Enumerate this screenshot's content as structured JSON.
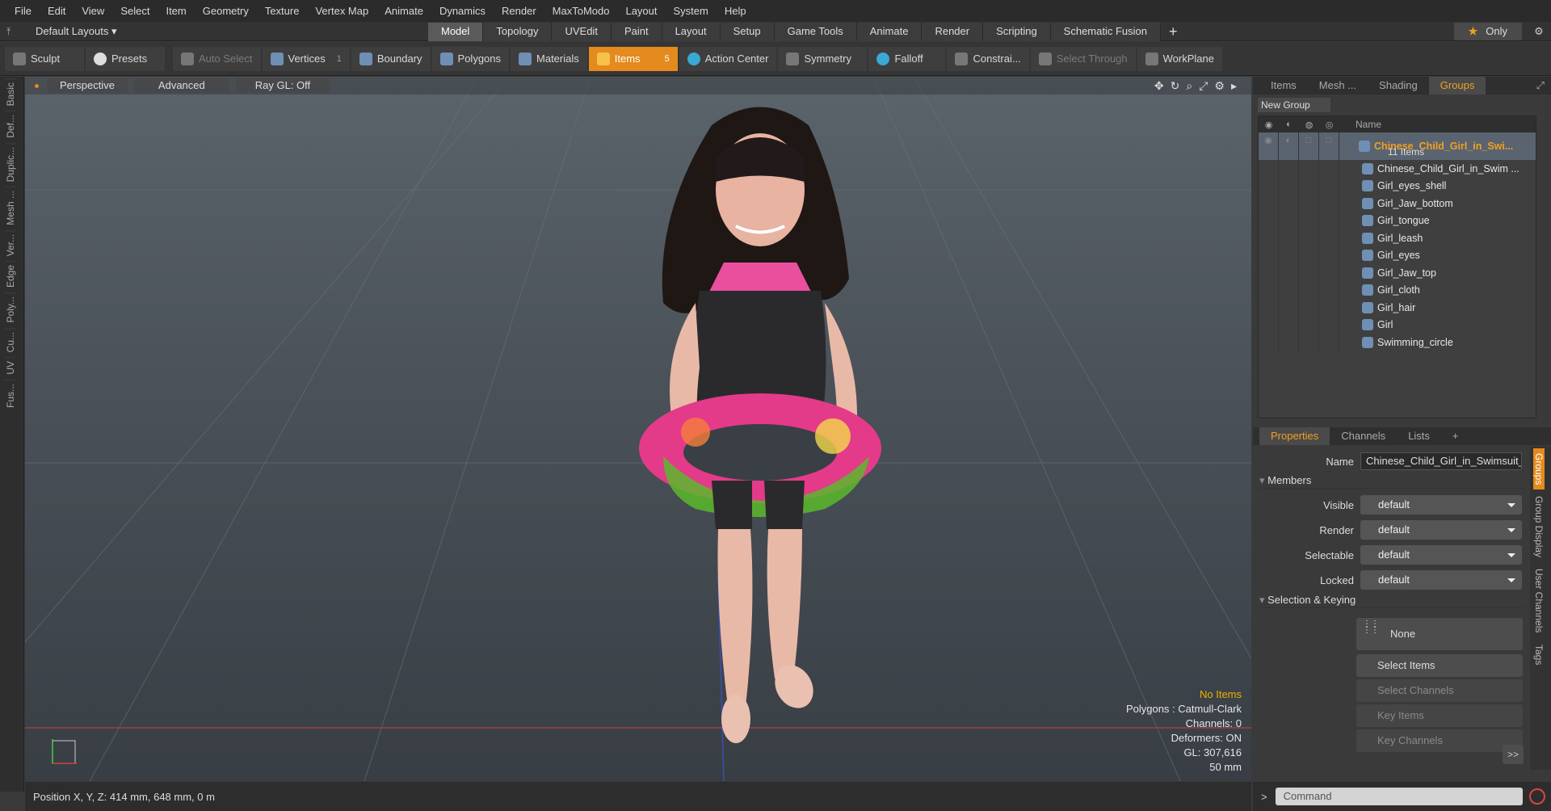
{
  "menu": [
    "File",
    "Edit",
    "View",
    "Select",
    "Item",
    "Geometry",
    "Texture",
    "Vertex Map",
    "Animate",
    "Dynamics",
    "Render",
    "MaxToModo",
    "Layout",
    "System",
    "Help"
  ],
  "layoutbar": {
    "layouts_label": "Default Layouts ▾",
    "tabs": [
      "Model",
      "Topology",
      "UVEdit",
      "Paint",
      "Layout",
      "Setup",
      "Game Tools",
      "Animate",
      "Render",
      "Scripting",
      "Schematic Fusion"
    ],
    "only_label": "Only"
  },
  "toolbar": {
    "sculpt": "Sculpt",
    "presets": "Presets",
    "auto_select": "Auto Select",
    "vertices": "Vertices",
    "vertices_count": "1",
    "boundary": "Boundary",
    "polygons": "Polygons",
    "materials": "Materials",
    "items": "Items",
    "items_count": "5",
    "action_center": "Action Center",
    "symmetry": "Symmetry",
    "falloff": "Falloff",
    "constrain": "Constrai...",
    "select_through": "Select Through",
    "workplane": "WorkPlane"
  },
  "left_tabs": [
    "Basic",
    "Def...",
    "Duplic...",
    "Mesh ...",
    "Ver...",
    "Edge",
    "Poly...",
    "Cu...",
    "UV",
    "Fus..."
  ],
  "viewport": {
    "perspective": "Perspective",
    "advanced": "Advanced",
    "raygl": "Ray GL: Off",
    "hud": {
      "no_items": "No Items",
      "polygons": "Polygons : Catmull-Clark",
      "channels": "Channels: 0",
      "deformers": "Deformers: ON",
      "gl": "GL: 307,616",
      "unit": "50 mm"
    }
  },
  "status": {
    "position": "Position X, Y, Z:  414 mm, 648 mm, 0 m"
  },
  "panel": {
    "tabs": [
      "Items",
      "Mesh ...",
      "Shading",
      "Groups"
    ],
    "new_group": "New Group",
    "name_col": "Name",
    "group": {
      "name": "Chinese_Child_Girl_in_Swi...",
      "count": "11 Items"
    },
    "items": [
      "Chinese_Child_Girl_in_Swim ...",
      "Girl_eyes_shell",
      "Girl_Jaw_bottom",
      "Girl_tongue",
      "Girl_leash",
      "Girl_eyes",
      "Girl_Jaw_top",
      "Girl_cloth",
      "Girl_hair",
      "Girl",
      "Swimming_circle"
    ]
  },
  "props": {
    "tabs": [
      "Properties",
      "Channels",
      "Lists"
    ],
    "name_label": "Name",
    "name_value": "Chinese_Child_Girl_in_Swimsuit_S",
    "members": "Members",
    "visible_label": "Visible",
    "visible": "default",
    "render_label": "Render",
    "render": "default",
    "selectable_label": "Selectable",
    "selectable": "default",
    "locked_label": "Locked",
    "locked": "default",
    "selkey": "Selection & Keying",
    "none": "None",
    "select_items": "Select Items",
    "select_channels": "Select Channels",
    "key_items": "Key Items",
    "key_channels": "Key Channels",
    "more": ">>",
    "vtabs": [
      "Groups",
      "Group Display",
      "User Channels",
      "Tags"
    ]
  },
  "command": {
    "placeholder": "Command"
  }
}
